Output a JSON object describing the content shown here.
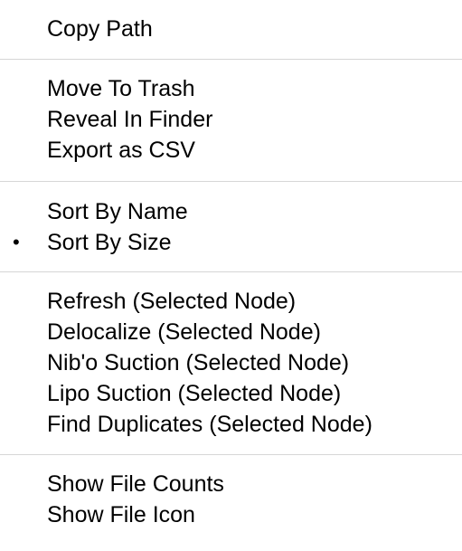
{
  "menu": {
    "groups": [
      {
        "items": [
          {
            "label": "Copy Path"
          }
        ]
      },
      {
        "items": [
          {
            "label": "Move To Trash"
          },
          {
            "label": "Reveal In Finder"
          },
          {
            "label": "Export as CSV"
          }
        ]
      },
      {
        "items": [
          {
            "label": "Sort By Name",
            "checked": false
          },
          {
            "label": "Sort By Size",
            "checked": true,
            "mark": "•"
          }
        ]
      },
      {
        "items": [
          {
            "label": "Refresh (Selected Node)"
          },
          {
            "label": "Delocalize (Selected Node)"
          },
          {
            "label": "Nib'o Suction (Selected Node)"
          },
          {
            "label": "Lipo Suction (Selected Node)"
          },
          {
            "label": "Find Duplicates (Selected Node)"
          }
        ]
      },
      {
        "items": [
          {
            "label": "Show File Counts"
          },
          {
            "label": "Show File Icon"
          }
        ]
      }
    ]
  },
  "colors": {
    "background": "#ffffff",
    "text": "#000000",
    "separator": "#d6d6d6"
  }
}
